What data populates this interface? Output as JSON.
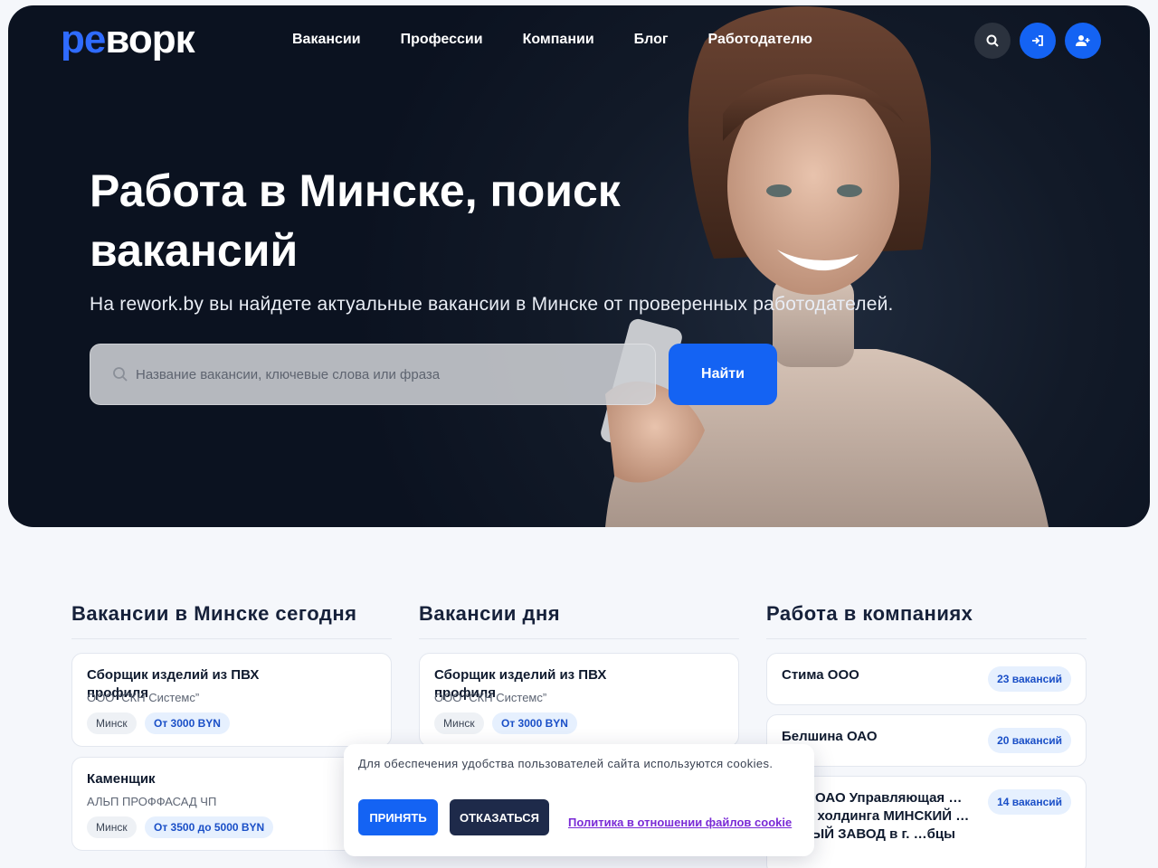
{
  "header": {
    "logo_part1": "ре",
    "logo_part2": "ворк",
    "nav": [
      "Вакансии",
      "Профессии",
      "Компании",
      "Блог",
      "Работодателю"
    ]
  },
  "hero": {
    "title": "Работа в Минске, поиск вакансий",
    "subtitle": "На rework.by вы найдете актуальные вакансии в Минске от проверенных работодателей.",
    "search_placeholder": "Название вакансии, ключевые слова или фраза",
    "search_button": "Найти"
  },
  "today": {
    "title": "Вакансии в Минске сегодня",
    "items": [
      {
        "title": "Сборщик изделий из ПВХ профиля",
        "company": "ООО “СКН Системс”",
        "city": "Минск",
        "salary": "От 3000 BYN"
      },
      {
        "title": "Каменщик",
        "company": "АЛЬП ПРОФФАСАД ЧП",
        "city": "Минск",
        "salary": "От 3500 до 5000 BYN"
      }
    ]
  },
  "day": {
    "title": "Вакансии дня",
    "items": [
      {
        "title": "Сборщик изделий из ПВХ профиля",
        "company": "ООО “СКН Системс”",
        "city": "Минск",
        "salary": "От 3000 BYN"
      }
    ]
  },
  "companies": {
    "title": "Работа в компаниях",
    "items": [
      {
        "name": "Стима ООО",
        "count": "23 вакансий"
      },
      {
        "name": "Белшина ОАО",
        "count": "20 вакансий"
      },
      {
        "name": "…ал ОАО Управляющая …ания холдинга МИНСКИЙ …ОРНЫЙ ЗАВОД в г. …бцы",
        "count": "14 вакансий"
      }
    ]
  },
  "cookie": {
    "text": "Для обеспечения удобства пользователей сайта используются cookies.",
    "accept": "ПРИНЯТЬ",
    "decline": "ОТКАЗАТЬСЯ",
    "policy": "Политика в отношении файлов cookie"
  },
  "colors": {
    "accent": "#1463f3",
    "dark": "#1e2a4a",
    "hero_bg": "#0b1220"
  }
}
